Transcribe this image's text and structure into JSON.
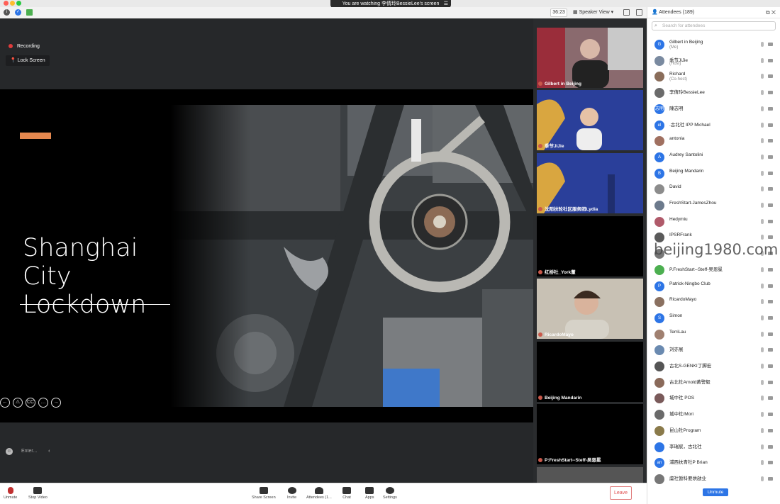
{
  "window": {
    "share_banner": "You are watching 李倩玲BessieLee's screen",
    "timer": "36:23",
    "view_mode": "Speaker View"
  },
  "stage": {
    "recording_label": "Recording",
    "lock_screen_label": "Lock Screen",
    "slide_title_line1": "Shanghai City",
    "slide_title_line2": "Lockdown",
    "slide_controls": [
      "←",
      "⚠",
      "CC",
      "…",
      "→"
    ],
    "chat_placeholder": "Enter..."
  },
  "thumbnails": [
    {
      "label": "Gilbert in Beijing"
    },
    {
      "label": "季节JiJie"
    },
    {
      "label": "沈阳扶轮社区服务团Lydia"
    },
    {
      "label": "红桥社_York董"
    },
    {
      "label": "RicardoMayo"
    },
    {
      "label": "Beijing Mandarin"
    },
    {
      "label": "P:FreshStart--Steff-吴恩冕"
    }
  ],
  "panel": {
    "title": "Attendees (189)",
    "search_placeholder": "Search for attendees",
    "unmute_label": "Unmute",
    "attendees": [
      {
        "initials": "G",
        "name": "Gilbert in Beijing",
        "sub": "(Me)",
        "color": "#2d75e6"
      },
      {
        "initials": "",
        "name": "季节JiJie",
        "sub": "(Host)",
        "color": "#7a8aa0"
      },
      {
        "initials": "",
        "name": "Richard",
        "sub": "(Co-host)",
        "color": "#8a6d5a"
      },
      {
        "initials": "",
        "name": "李倩玲BessieLee",
        "sub": "",
        "color": "#6b6b6b"
      },
      {
        "initials": "志明",
        "name": "陳志明",
        "sub": "",
        "color": "#2d75e6"
      },
      {
        "initials": "el",
        "name": ".古北社 IPP Michael",
        "sub": "",
        "color": "#2d75e6"
      },
      {
        "initials": "",
        "name": "antonia",
        "sub": "",
        "color": "#a07060"
      },
      {
        "initials": "A",
        "name": "Audrey Santolini",
        "sub": "",
        "color": "#2d75e6"
      },
      {
        "initials": "B",
        "name": "Beijing Mandarin",
        "sub": "",
        "color": "#2d75e6"
      },
      {
        "initials": "",
        "name": "David",
        "sub": "",
        "color": "#8c8c8c"
      },
      {
        "initials": "",
        "name": "FreshStart-JamesZhou",
        "sub": "",
        "color": "#6c7a8c"
      },
      {
        "initials": "",
        "name": "Hedymiu",
        "sub": "",
        "color": "#b05a6a"
      },
      {
        "initials": "",
        "name": "IPSRFrank",
        "sub": "",
        "color": "#5a5a5a"
      },
      {
        "initials": "",
        "name": "",
        "sub": "",
        "color": "#777777"
      },
      {
        "initials": "",
        "name": "P.FreshStart--Steff-吴恩冕",
        "sub": "",
        "color": "#4caf50"
      },
      {
        "initials": "P",
        "name": "Patrick-Ningbo Club",
        "sub": "",
        "color": "#2d75e6"
      },
      {
        "initials": "",
        "name": "RicardoMayo",
        "sub": "",
        "color": "#8a7060"
      },
      {
        "initials": "S",
        "name": "Simon",
        "sub": "",
        "color": "#2d75e6"
      },
      {
        "initials": "",
        "name": "TerriLau",
        "sub": "",
        "color": "#a08070"
      },
      {
        "initials": "",
        "name": "刘亦展",
        "sub": "",
        "color": "#6a8ab0"
      },
      {
        "initials": "",
        "name": "古北S-GENKI丁脚宏",
        "sub": "",
        "color": "#555555"
      },
      {
        "initials": "",
        "name": "古北社Arnold黃警毅",
        "sub": "",
        "color": "#8a6a5a"
      },
      {
        "initials": "",
        "name": "城中社 POS",
        "sub": "",
        "color": "#7a5a5a"
      },
      {
        "initials": "",
        "name": "城中社/Mori",
        "sub": "",
        "color": "#6a6a6a"
      },
      {
        "initials": "",
        "name": "昆山社Program",
        "sub": "",
        "color": "#8a7a4a"
      },
      {
        "initials": "",
        "name": "李瑞宸，古北社",
        "sub": "",
        "color": "#2d75e6"
      },
      {
        "initials": "an",
        "name": "浦西扶青社P Brian",
        "sub": "",
        "color": "#2d75e6"
      },
      {
        "initials": "",
        "name": "虞社暂科要烘啟业",
        "sub": "",
        "color": "#777777"
      }
    ]
  },
  "watermark": "beijing1980.com",
  "bottombar": {
    "unmute": "Unmute",
    "stop_video": "Stop Video",
    "share_screen": "Share Screen",
    "invite": "Invite",
    "attendees": "Attendees (1...",
    "chat": "Chat",
    "apps": "Apps",
    "settings": "Settings",
    "leave": "Leave"
  }
}
